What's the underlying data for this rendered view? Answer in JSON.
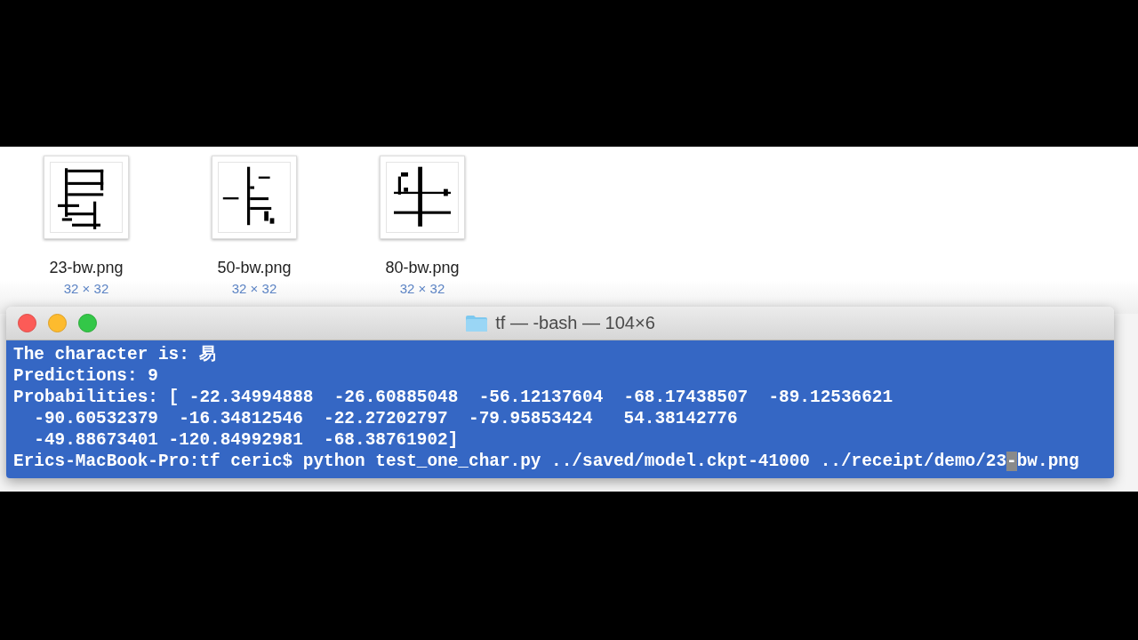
{
  "files": [
    {
      "name": "23-bw.png",
      "dimensions": "32 × 32",
      "kind": "picture"
    },
    {
      "name": "50-bw.png",
      "dimensions": "32 × 32",
      "kind": "picture"
    },
    {
      "name": "80-bw.png",
      "dimensions": "32 × 32",
      "kind": "picture"
    }
  ],
  "terminal": {
    "title": "tf — -bash — 104×6",
    "lines": [
      {
        "text": "The character is: 易"
      },
      {
        "text": "Predictions: 9"
      },
      {
        "text": "Probabilities: [ -22.34994888  -26.60885048  -56.12137604  -68.17438507  -89.12536621"
      },
      {
        "text": "  -90.60532379  -16.34812546  -22.27202797  -79.95853424   54.38142776"
      },
      {
        "text": "  -49.88673401 -120.84992981  -68.38761902]"
      },
      {
        "text": "Erics-MacBook-Pro:tf ceric$ python test_one_char.py ../saved/model.ckpt-41000 ../receipt/demo/23",
        "cursor": "-",
        "after": "bw.png"
      }
    ]
  }
}
